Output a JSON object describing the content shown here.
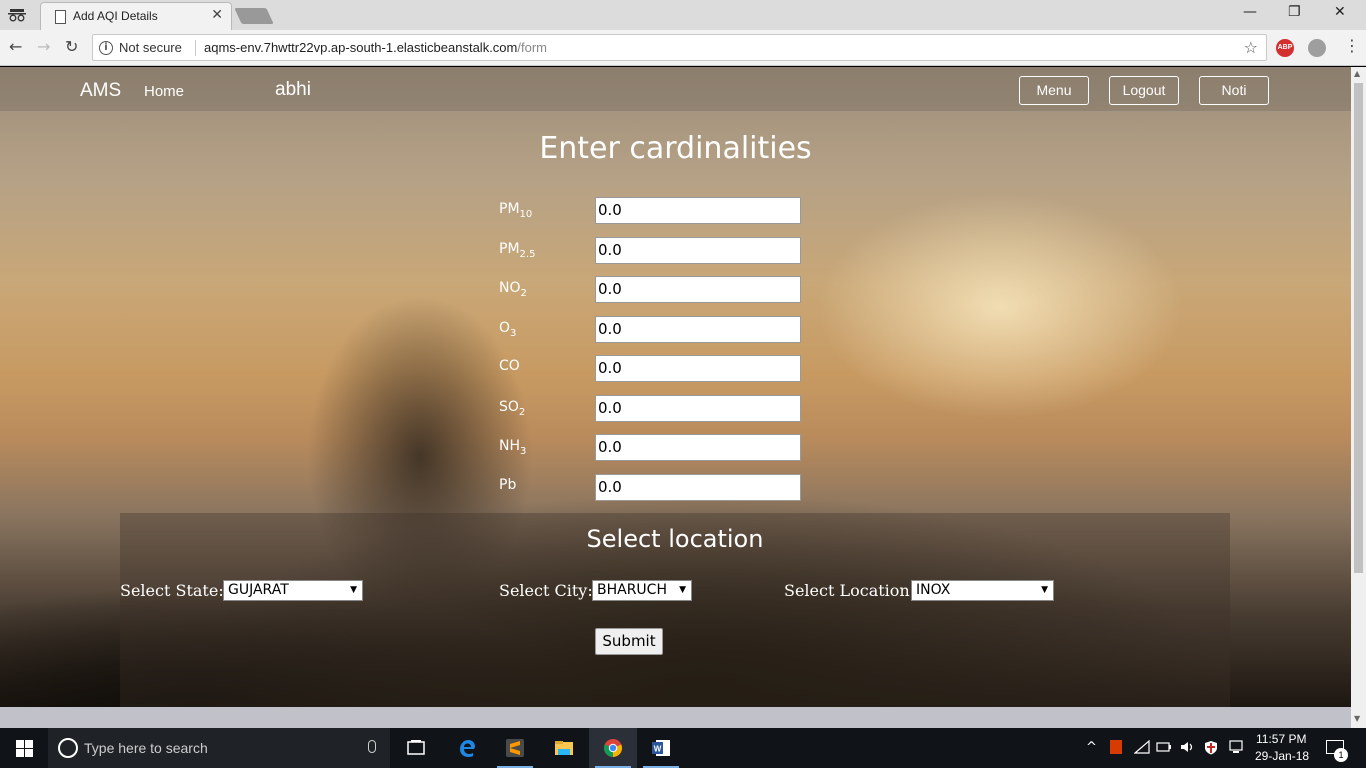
{
  "browser": {
    "tab_title": "Add AQI Details",
    "tab_close": "✕",
    "window_minimize": "—",
    "window_restore": "❐",
    "window_close": "✕",
    "back": "←",
    "forward": "→",
    "reload": "↻",
    "security_label": "Not secure",
    "url_host": "aqms-env.7hwttr22vp.ap-south-1.elasticbeanstalk.com",
    "url_path": "/form",
    "star": "☆",
    "abp_label": "ABP",
    "menu": "⋮"
  },
  "navbar": {
    "brand": "AMS",
    "home": "Home",
    "username": "abhi",
    "menu_button": "Menu",
    "logout_button": "Logout",
    "noti_button": "Noti"
  },
  "form": {
    "title": "Enter cardinalities",
    "fields": [
      {
        "base": "PM",
        "sub": "10",
        "value": "0.0"
      },
      {
        "base": "PM",
        "sub": "2.5",
        "value": "0.0"
      },
      {
        "base": "NO",
        "sub": "2",
        "value": "0.0"
      },
      {
        "base": "O",
        "sub": "3",
        "value": "0.0"
      },
      {
        "base": "CO",
        "sub": "",
        "value": "0.0"
      },
      {
        "base": "SO",
        "sub": "2",
        "value": "0.0"
      },
      {
        "base": "NH",
        "sub": "3",
        "value": "0.0"
      },
      {
        "base": "Pb",
        "sub": "",
        "value": "0.0"
      }
    ]
  },
  "location": {
    "title": "Select location",
    "state_label": "Select State:",
    "state_value": "GUJARAT",
    "city_label": "Select City:",
    "city_value": "BHARUCH",
    "location_label": "Select Location:",
    "location_value": "INOX",
    "caret": "▼",
    "submit": "Submit"
  },
  "taskbar": {
    "search_placeholder": "Type here to search",
    "tray_up": "^",
    "time": "11:57 PM",
    "date": "29-Jan-18",
    "notification_count": "1"
  },
  "colors": {
    "accent": "#7db2e8",
    "page_text": "#ffffff",
    "taskbar": "#101418"
  }
}
